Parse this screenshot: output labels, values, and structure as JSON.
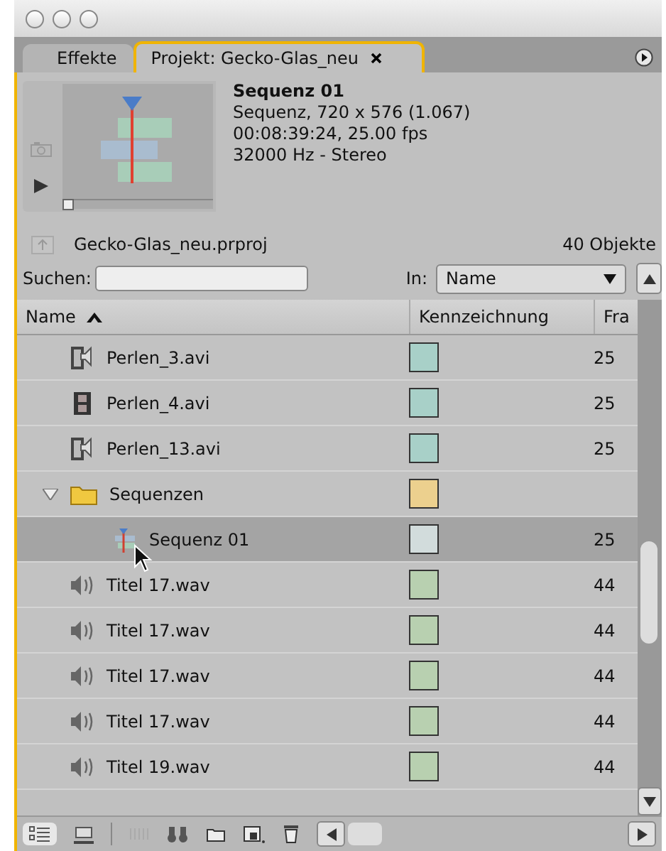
{
  "tabs": [
    {
      "label": "Effekte",
      "selected": false
    },
    {
      "label": "Projekt: Gecko-Glas_neu",
      "selected": true
    }
  ],
  "preview": {
    "title": "Sequenz 01",
    "lines": [
      "Sequenz, 720 x 576 (1.067)",
      "00:08:39:24, 25.00 fps",
      "32000 Hz - Stereo"
    ],
    "level": 0
  },
  "project": {
    "file": "Gecko-Glas_neu.prproj",
    "count": "40 Objekte"
  },
  "search": {
    "label": "Suchen:",
    "in_label": "In:",
    "in_value": "Name"
  },
  "table": {
    "columns": [
      "Name",
      "Kennzeichnung",
      "Fra"
    ],
    "rows": [
      {
        "kind": "clip",
        "name": "Perlen_3.avi",
        "color": "#a8d0c8",
        "column_3": "25",
        "selected": false
      },
      {
        "kind": "film",
        "name": "Perlen_4.avi",
        "color": "#a8d0c8",
        "column_3": "25",
        "selected": false
      },
      {
        "kind": "clip",
        "name": "Perlen_13.avi",
        "color": "#a8d0c8",
        "column_3": "25",
        "selected": false
      },
      {
        "kind": "folder",
        "name": "Sequenzen",
        "color": "#ecd08e",
        "selected": false,
        "expanded": true,
        "children": [
          {
            "kind": "sequence",
            "name": "Sequenz 01",
            "color": "#d2dcdc",
            "column_3": "25",
            "selected": true
          }
        ]
      },
      {
        "kind": "audio",
        "name": "Titel 17.wav",
        "color": "#b8d0b0",
        "column_3": "44",
        "selected": false
      },
      {
        "kind": "audio",
        "name": "Titel 17.wav",
        "color": "#b8d0b0",
        "column_3": "44",
        "selected": false
      },
      {
        "kind": "audio",
        "name": "Titel 17.wav",
        "color": "#b8d0b0",
        "column_3": "44",
        "selected": false
      },
      {
        "kind": "audio",
        "name": "Titel 17.wav",
        "color": "#b8d0b0",
        "column_3": "44",
        "selected": false
      },
      {
        "kind": "audio",
        "name": "Titel 19.wav",
        "color": "#b8d0b0",
        "column_3": "44",
        "selected": false
      }
    ]
  }
}
